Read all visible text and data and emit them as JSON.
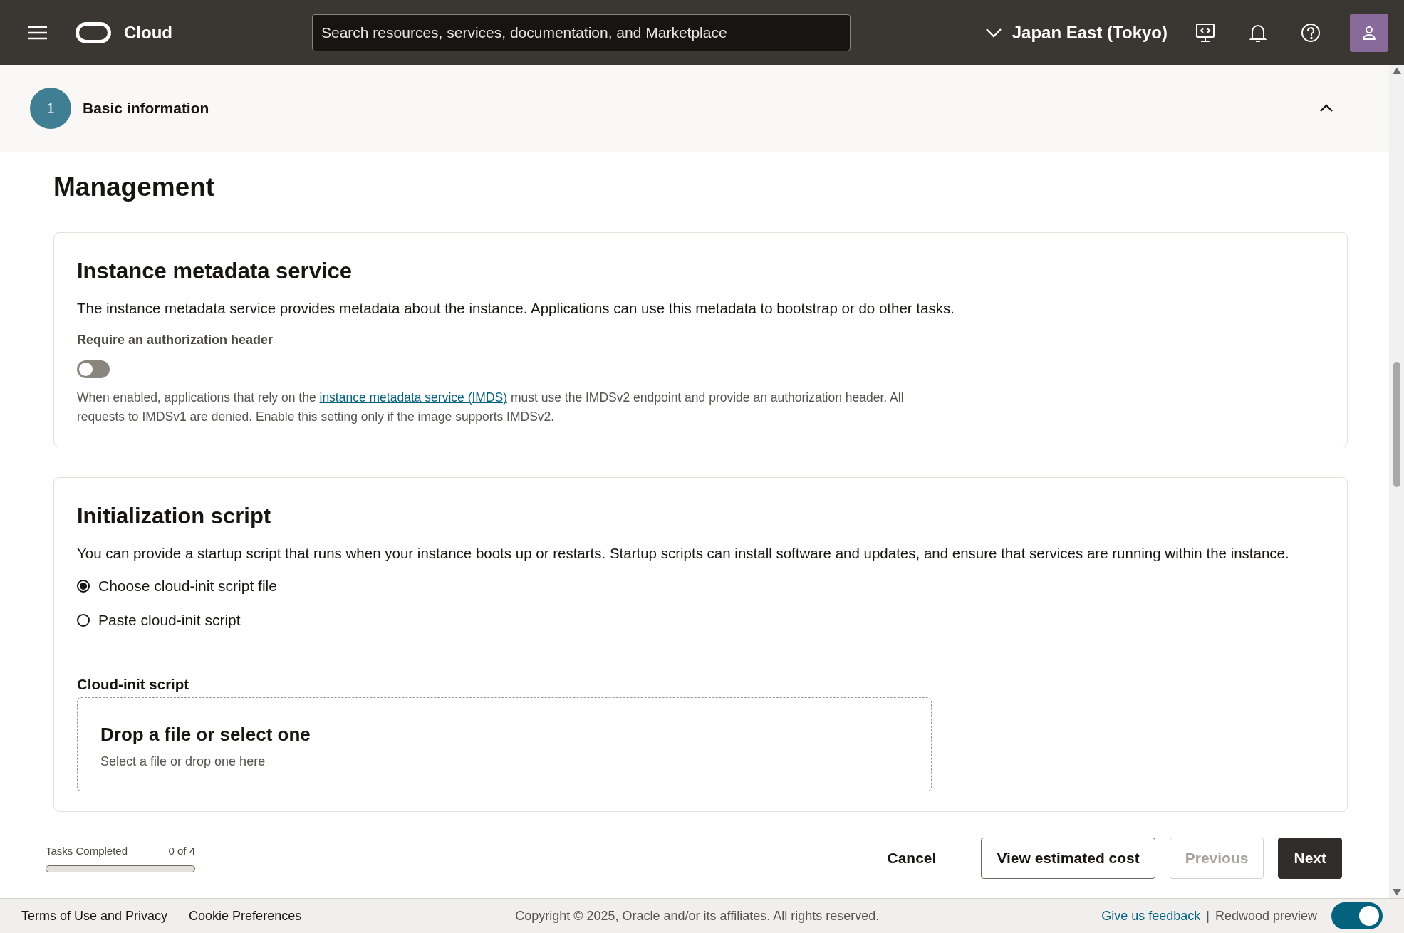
{
  "header": {
    "brand": "Cloud",
    "search": {
      "placeholder": "Search resources, services, documentation, and Marketplace"
    },
    "region": "Japan East (Tokyo)"
  },
  "step": {
    "number": "1",
    "title": "Basic information",
    "expanded": true
  },
  "page_title": "Management",
  "sections": [
    {
      "kind": "toggle",
      "title": "Instance metadata service",
      "description": "The instance metadata service provides metadata about the instance. Applications can use this metadata to bootstrap or do other tasks.",
      "label": "Require an authorization header",
      "on": false,
      "help_before": "When enabled, applications that rely on the ",
      "help_link": "instance metadata service (IMDS)",
      "help_after": " must use the IMDSv2 endpoint and provide an authorization header. All requests to IMDSv1 are denied. Enable this setting only if the image supports IMDSv2."
    },
    {
      "kind": "script",
      "title": "Initialization script",
      "description": "You can provide a startup script that runs when your instance boots up or restarts. Startup scripts can install software and updates, and ensure that services are running within the instance.",
      "options": [
        {
          "label": "Choose cloud-init script file",
          "selected": true
        },
        {
          "label": "Paste cloud-init script",
          "selected": false
        }
      ],
      "field_label": "Cloud-init script",
      "dropzone": {
        "title": "Drop a file or select one",
        "hint": "Select a file or drop one here"
      }
    }
  ],
  "footer": {
    "tasks": {
      "label": "Tasks Completed",
      "count": "0 of 4",
      "level": 0
    },
    "buttons": [
      {
        "label": "Cancel",
        "kind": "text",
        "disabled": false
      },
      {
        "label": "View estimated cost",
        "kind": "outline",
        "disabled": false
      },
      {
        "label": "Previous",
        "kind": "outline",
        "disabled": true
      },
      {
        "label": "Next",
        "kind": "primary",
        "disabled": false
      }
    ]
  },
  "bottom_bar": {
    "links": [
      "Terms of Use and Privacy",
      "Cookie Preferences"
    ],
    "copyright": "Copyright © 2025, Oracle and/or its affiliates. All rights reserved.",
    "feedback": "Give us feedback",
    "separator": "|",
    "preview_label": "Redwood preview",
    "preview_on": true
  }
}
